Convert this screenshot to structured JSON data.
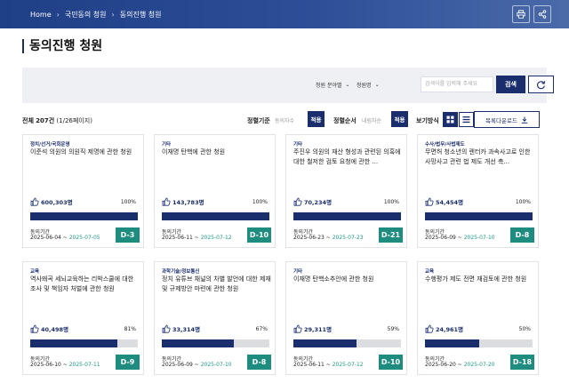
{
  "breadcrumb": {
    "home": "Home",
    "section": "국민동의 청원",
    "current": "동의진행 청원"
  },
  "page_title": "동의진행 청원",
  "filters": {
    "field_select": "청원 분야별",
    "status_select": "청원명",
    "search_placeholder": "검색어를 입력해 주세요",
    "search_button": "검색"
  },
  "listing": {
    "total_label": "전체",
    "total": "207건",
    "pages": "(1/26페이지)",
    "sort_label": "정렬기준",
    "sort_value": "동의자수",
    "sort_apply": "적용",
    "order_label": "정렬순서",
    "order_value": "내림차순",
    "order_apply": "적용",
    "view_label": "보기방식",
    "download_label": "목록다운로드"
  },
  "colors": {
    "navy": "#1a2e6e",
    "teal": "#1e8c7e",
    "bar_bg": "#dcdde0"
  },
  "cards": [
    {
      "category": "정치/선거/국회운영",
      "title": "이준석 의원의 의원직 제명에 관한 청원",
      "count": "600,303명",
      "percent": "100%",
      "progress": 1.0,
      "period_label": "동의기간",
      "start": "2025-06-04 ~",
      "end": "2025-07-05",
      "dday": "D-3"
    },
    {
      "category": "기타",
      "title": "이재명 탄핵에 관한 청원",
      "count": "143,783명",
      "percent": "100%",
      "progress": 1.0,
      "period_label": "동의기간",
      "start": "2025-06-11 ~",
      "end": "2025-07-12",
      "dday": "D-10"
    },
    {
      "category": "기타",
      "title": "주진우 의원의 재산 형성과 관련된 의혹에 대한 철저한 검토 요청에 관한 ...",
      "count": "70,234명",
      "percent": "100%",
      "progress": 1.0,
      "period_label": "동의기간",
      "start": "2025-06-23 ~",
      "end": "2025-07-23",
      "dday": "D-21"
    },
    {
      "category": "수사/법무/사법제도",
      "title": "무면허 청소년의 렌터카 과속사고로 인한 사망사고 관련 법 제도 개선 촉...",
      "count": "54,454명",
      "percent": "100%",
      "progress": 1.0,
      "period_label": "동의기간",
      "start": "2025-06-09 ~",
      "end": "2025-07-10",
      "dday": "D-8"
    },
    {
      "category": "교육",
      "title": "역사왜곡 세뇌교육하는 리박스쿨에 대한 조사 및 책임자 처벌에 관한 청원",
      "count": "40,498명",
      "percent": "81%",
      "progress": 0.81,
      "period_label": "동의기간",
      "start": "2025-06-10 ~",
      "end": "2025-07-11",
      "dday": "D-9"
    },
    {
      "category": "과학기술/정보통신",
      "title": "정치 유튜브 채널의 차별 발언에 대한 제재 및 규제방안 마련에 관한 청원",
      "count": "33,314명",
      "percent": "67%",
      "progress": 0.67,
      "period_label": "동의기간",
      "start": "2025-06-09 ~",
      "end": "2025-07-10",
      "dday": "D-8"
    },
    {
      "category": "기타",
      "title": "이재명 탄핵소추안에 관한 청원",
      "count": "29,311명",
      "percent": "59%",
      "progress": 0.59,
      "period_label": "동의기간",
      "start": "2025-06-11 ~",
      "end": "2025-07-12",
      "dday": "D-10"
    },
    {
      "category": "교육",
      "title": "수행평가 제도 전면 재검토에 관한 청원",
      "count": "24,961명",
      "percent": "50%",
      "progress": 0.5,
      "period_label": "동의기간",
      "start": "2025-06-20 ~",
      "end": "2025-07-20",
      "dday": "D-18"
    }
  ]
}
